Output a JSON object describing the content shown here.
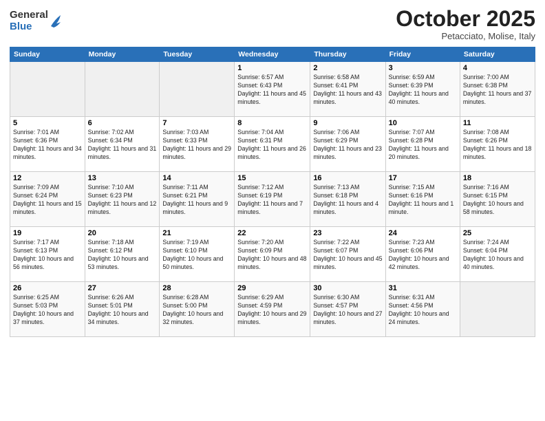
{
  "header": {
    "logo_general": "General",
    "logo_blue": "Blue",
    "month": "October 2025",
    "location": "Petacciato, Molise, Italy"
  },
  "days_of_week": [
    "Sunday",
    "Monday",
    "Tuesday",
    "Wednesday",
    "Thursday",
    "Friday",
    "Saturday"
  ],
  "weeks": [
    [
      {
        "day": "",
        "info": ""
      },
      {
        "day": "",
        "info": ""
      },
      {
        "day": "",
        "info": ""
      },
      {
        "day": "1",
        "info": "Sunrise: 6:57 AM\nSunset: 6:43 PM\nDaylight: 11 hours and 45 minutes."
      },
      {
        "day": "2",
        "info": "Sunrise: 6:58 AM\nSunset: 6:41 PM\nDaylight: 11 hours and 43 minutes."
      },
      {
        "day": "3",
        "info": "Sunrise: 6:59 AM\nSunset: 6:39 PM\nDaylight: 11 hours and 40 minutes."
      },
      {
        "day": "4",
        "info": "Sunrise: 7:00 AM\nSunset: 6:38 PM\nDaylight: 11 hours and 37 minutes."
      }
    ],
    [
      {
        "day": "5",
        "info": "Sunrise: 7:01 AM\nSunset: 6:36 PM\nDaylight: 11 hours and 34 minutes."
      },
      {
        "day": "6",
        "info": "Sunrise: 7:02 AM\nSunset: 6:34 PM\nDaylight: 11 hours and 31 minutes."
      },
      {
        "day": "7",
        "info": "Sunrise: 7:03 AM\nSunset: 6:33 PM\nDaylight: 11 hours and 29 minutes."
      },
      {
        "day": "8",
        "info": "Sunrise: 7:04 AM\nSunset: 6:31 PM\nDaylight: 11 hours and 26 minutes."
      },
      {
        "day": "9",
        "info": "Sunrise: 7:06 AM\nSunset: 6:29 PM\nDaylight: 11 hours and 23 minutes."
      },
      {
        "day": "10",
        "info": "Sunrise: 7:07 AM\nSunset: 6:28 PM\nDaylight: 11 hours and 20 minutes."
      },
      {
        "day": "11",
        "info": "Sunrise: 7:08 AM\nSunset: 6:26 PM\nDaylight: 11 hours and 18 minutes."
      }
    ],
    [
      {
        "day": "12",
        "info": "Sunrise: 7:09 AM\nSunset: 6:24 PM\nDaylight: 11 hours and 15 minutes."
      },
      {
        "day": "13",
        "info": "Sunrise: 7:10 AM\nSunset: 6:23 PM\nDaylight: 11 hours and 12 minutes."
      },
      {
        "day": "14",
        "info": "Sunrise: 7:11 AM\nSunset: 6:21 PM\nDaylight: 11 hours and 9 minutes."
      },
      {
        "day": "15",
        "info": "Sunrise: 7:12 AM\nSunset: 6:19 PM\nDaylight: 11 hours and 7 minutes."
      },
      {
        "day": "16",
        "info": "Sunrise: 7:13 AM\nSunset: 6:18 PM\nDaylight: 11 hours and 4 minutes."
      },
      {
        "day": "17",
        "info": "Sunrise: 7:15 AM\nSunset: 6:16 PM\nDaylight: 11 hours and 1 minute."
      },
      {
        "day": "18",
        "info": "Sunrise: 7:16 AM\nSunset: 6:15 PM\nDaylight: 10 hours and 58 minutes."
      }
    ],
    [
      {
        "day": "19",
        "info": "Sunrise: 7:17 AM\nSunset: 6:13 PM\nDaylight: 10 hours and 56 minutes."
      },
      {
        "day": "20",
        "info": "Sunrise: 7:18 AM\nSunset: 6:12 PM\nDaylight: 10 hours and 53 minutes."
      },
      {
        "day": "21",
        "info": "Sunrise: 7:19 AM\nSunset: 6:10 PM\nDaylight: 10 hours and 50 minutes."
      },
      {
        "day": "22",
        "info": "Sunrise: 7:20 AM\nSunset: 6:09 PM\nDaylight: 10 hours and 48 minutes."
      },
      {
        "day": "23",
        "info": "Sunrise: 7:22 AM\nSunset: 6:07 PM\nDaylight: 10 hours and 45 minutes."
      },
      {
        "day": "24",
        "info": "Sunrise: 7:23 AM\nSunset: 6:06 PM\nDaylight: 10 hours and 42 minutes."
      },
      {
        "day": "25",
        "info": "Sunrise: 7:24 AM\nSunset: 6:04 PM\nDaylight: 10 hours and 40 minutes."
      }
    ],
    [
      {
        "day": "26",
        "info": "Sunrise: 6:25 AM\nSunset: 5:03 PM\nDaylight: 10 hours and 37 minutes."
      },
      {
        "day": "27",
        "info": "Sunrise: 6:26 AM\nSunset: 5:01 PM\nDaylight: 10 hours and 34 minutes."
      },
      {
        "day": "28",
        "info": "Sunrise: 6:28 AM\nSunset: 5:00 PM\nDaylight: 10 hours and 32 minutes."
      },
      {
        "day": "29",
        "info": "Sunrise: 6:29 AM\nSunset: 4:59 PM\nDaylight: 10 hours and 29 minutes."
      },
      {
        "day": "30",
        "info": "Sunrise: 6:30 AM\nSunset: 4:57 PM\nDaylight: 10 hours and 27 minutes."
      },
      {
        "day": "31",
        "info": "Sunrise: 6:31 AM\nSunset: 4:56 PM\nDaylight: 10 hours and 24 minutes."
      },
      {
        "day": "",
        "info": ""
      }
    ]
  ]
}
